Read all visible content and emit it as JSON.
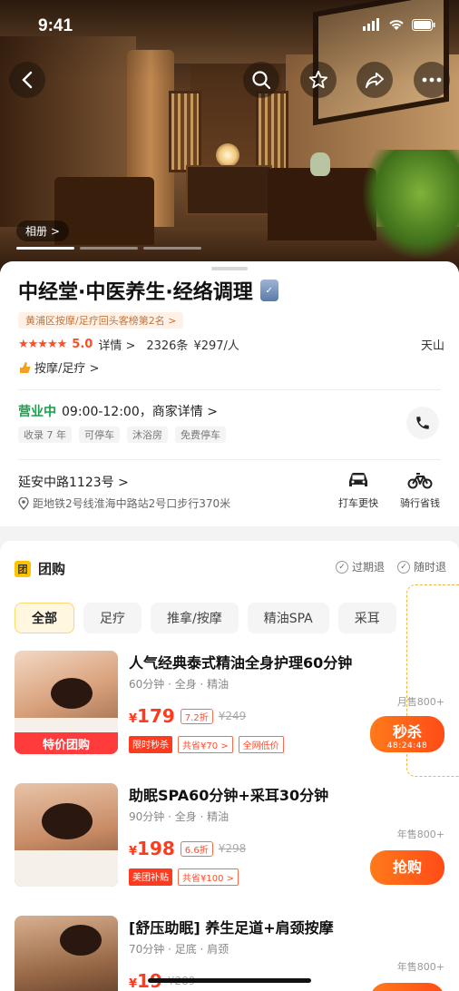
{
  "status": {
    "time": "9:41"
  },
  "hero": {
    "album_label": "相册 >"
  },
  "shop": {
    "name": "中经堂·中医养生·经络调理",
    "rank": "黄浦区按摩/足疗回头客榜第2名 >",
    "stars": "★★★★★",
    "score": "5.0",
    "detail_label": "详情 >",
    "reviews": "2326条",
    "avg_price": "¥297/人",
    "district": "天山",
    "category": "按摩/足疗 >",
    "open_status": "营业中",
    "hours": "09:00-12:00，商家详情 >",
    "tags": [
      "收录 7 年",
      "可停车",
      "沐浴房",
      "免费停车"
    ],
    "address": "延安中路1123号 >",
    "metro": "距地铁2号线淮海中路站2号口步行370米",
    "nav_taxi": "打车更快",
    "nav_bike": "骑行省钱"
  },
  "group": {
    "title": "团购",
    "guarantee_1": "过期退",
    "guarantee_2": "随时退",
    "filters": [
      "全部",
      "足疗",
      "推拿/按摩",
      "精油SPA",
      "采耳"
    ],
    "deals": [
      {
        "title": "人气经典泰式精油全身护理60分钟",
        "sub": "60分钟 · 全身 · 精油",
        "price": "179",
        "discount": "7.2折",
        "orig": "¥249",
        "tag1": "限时秒杀",
        "tag2": "共省¥70 >",
        "tag3": "全网低价",
        "sold": "月售800+",
        "cta": "秒杀",
        "countdown": "48:24:48",
        "ribbon": "特价团购"
      },
      {
        "title": "助眠SPA60分钟+采耳30分钟",
        "sub": "90分钟 · 全身 · 精油",
        "price": "198",
        "discount": "6.6折",
        "orig": "¥298",
        "tag1": "美团补贴",
        "tag2": "共省¥100 >",
        "sold": "年售800+",
        "cta": "抢购"
      },
      {
        "title": "[舒压助眠] 养生足道+肩颈按摩",
        "sub": "70分钟 · 足底 · 肩颈",
        "price": "19",
        "discount": "",
        "orig": "¥289",
        "sold": "年售800+",
        "cta": ""
      }
    ]
  },
  "colors": {
    "accent": "#ff4b17",
    "open": "#16a34a",
    "star": "#ff4d26"
  }
}
